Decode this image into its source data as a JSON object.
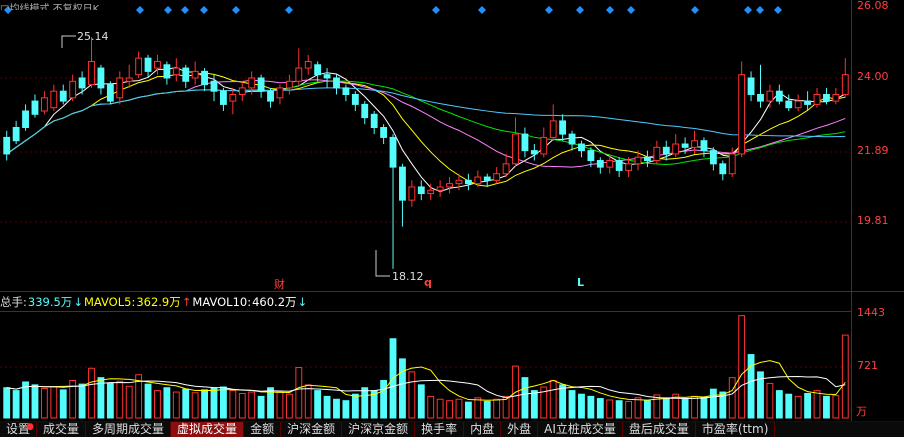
{
  "header": {
    "title": "□均线模式 不复权日K"
  },
  "price_axis": [
    "26.08",
    "24.00",
    "21.89",
    "19.81"
  ],
  "annotations": {
    "high": "25.14",
    "low": "18.12",
    "markers": [
      "财",
      "q",
      "L"
    ]
  },
  "volume_info": {
    "total_label": "总手:",
    "total_value": "339.5万",
    "mavol5_label": "MAVOL5:",
    "mavol5_value": "362.9万",
    "mavol10_label": "MAVOL10:",
    "mavol10_value": "460.2万"
  },
  "volume_axis": [
    "1443",
    "721",
    "万"
  ],
  "tabs": [
    "设置",
    "成交量",
    "多周期成交量",
    "虚拟成交量",
    "金额",
    "沪深金额",
    "沪深京金额",
    "换手率",
    "内盘",
    "外盘",
    "AI立桩成交量",
    "盘后成交量",
    "市盈率(ttm)"
  ],
  "active_tab": 3,
  "colors": {
    "up": "#ff3232",
    "down": "#54fcfc",
    "ma5": "#ffffff",
    "ma10": "#ffff00",
    "ma20": "#ff80ff",
    "ma30": "#00e600",
    "ma60": "#50c8ff",
    "axis": "#b40000",
    "diamond": "#1e90ff"
  },
  "chart_data": {
    "type": "candlestick",
    "ylim": [
      17.6,
      26.08
    ],
    "volume_ylim": [
      0,
      1443
    ],
    "candles": [
      [
        22.1,
        21.6,
        21.4,
        22.3,
        420
      ],
      [
        22.4,
        22.0,
        21.9,
        22.6,
        380
      ],
      [
        22.9,
        22.4,
        22.3,
        23.1,
        500
      ],
      [
        23.2,
        22.8,
        22.7,
        23.4,
        460
      ],
      [
        22.9,
        23.3,
        22.8,
        23.5,
        410
      ],
      [
        23.0,
        23.5,
        22.9,
        23.7,
        430
      ],
      [
        23.5,
        23.2,
        23.1,
        23.7,
        390
      ],
      [
        23.3,
        23.8,
        23.2,
        24.0,
        520
      ],
      [
        23.9,
        23.6,
        23.4,
        24.1,
        470
      ],
      [
        23.7,
        24.4,
        23.6,
        25.14,
        690
      ],
      [
        24.2,
        23.6,
        23.4,
        24.3,
        560
      ],
      [
        23.7,
        23.2,
        23.1,
        23.8,
        480
      ],
      [
        23.3,
        23.9,
        23.1,
        24.1,
        510
      ],
      [
        23.8,
        23.9,
        23.6,
        24.3,
        440
      ],
      [
        24.0,
        24.5,
        23.9,
        24.7,
        600
      ],
      [
        24.5,
        24.1,
        23.9,
        24.6,
        470
      ],
      [
        24.2,
        24.4,
        24.0,
        24.6,
        380
      ],
      [
        24.3,
        23.9,
        23.7,
        24.4,
        420
      ],
      [
        24.0,
        24.2,
        23.8,
        24.5,
        360
      ],
      [
        24.2,
        23.8,
        23.6,
        24.3,
        400
      ],
      [
        23.9,
        24.1,
        23.7,
        24.4,
        350
      ],
      [
        24.1,
        23.7,
        23.5,
        24.2,
        390
      ],
      [
        23.8,
        23.5,
        23.2,
        24.0,
        410
      ],
      [
        23.5,
        23.1,
        22.9,
        23.6,
        430
      ],
      [
        23.2,
        23.4,
        22.8,
        23.6,
        380
      ],
      [
        23.4,
        23.6,
        23.2,
        23.8,
        340
      ],
      [
        23.6,
        23.9,
        23.4,
        24.1,
        360
      ],
      [
        23.9,
        23.5,
        23.3,
        24.0,
        300
      ],
      [
        23.5,
        23.2,
        23.0,
        23.6,
        420
      ],
      [
        23.3,
        23.6,
        23.1,
        23.7,
        360
      ],
      [
        23.6,
        23.8,
        23.4,
        24.0,
        330
      ],
      [
        23.8,
        24.2,
        23.7,
        24.8,
        700
      ],
      [
        24.2,
        24.4,
        24.0,
        24.6,
        460
      ],
      [
        24.3,
        24.0,
        23.8,
        24.4,
        380
      ],
      [
        24.0,
        23.9,
        23.6,
        24.2,
        300
      ],
      [
        23.9,
        23.6,
        23.4,
        24.0,
        260
      ],
      [
        23.6,
        23.4,
        23.2,
        23.7,
        240
      ],
      [
        23.4,
        23.1,
        22.9,
        23.5,
        330
      ],
      [
        23.1,
        22.7,
        22.5,
        23.2,
        420
      ],
      [
        22.8,
        22.4,
        22.2,
        22.9,
        380
      ],
      [
        22.4,
        22.1,
        21.9,
        22.5,
        520
      ],
      [
        22.1,
        21.2,
        18.12,
        22.2,
        1100
      ],
      [
        21.2,
        20.2,
        19.4,
        21.3,
        820
      ],
      [
        20.2,
        20.6,
        20.0,
        20.8,
        640
      ],
      [
        20.6,
        20.4,
        20.2,
        20.8,
        460
      ],
      [
        20.4,
        20.5,
        20.2,
        20.7,
        300
      ],
      [
        20.5,
        20.6,
        20.3,
        20.8,
        260
      ],
      [
        20.6,
        20.7,
        20.4,
        20.9,
        240
      ],
      [
        20.7,
        20.8,
        20.5,
        21.0,
        260
      ],
      [
        20.8,
        20.7,
        20.5,
        21.0,
        220
      ],
      [
        20.7,
        20.9,
        20.6,
        21.1,
        280
      ],
      [
        20.9,
        20.8,
        20.6,
        21.0,
        230
      ],
      [
        20.8,
        21.0,
        20.7,
        21.2,
        260
      ],
      [
        21.0,
        21.3,
        20.9,
        21.6,
        300
      ],
      [
        21.3,
        22.2,
        21.2,
        22.7,
        720
      ],
      [
        22.2,
        21.7,
        21.5,
        22.4,
        560
      ],
      [
        21.7,
        21.6,
        21.4,
        21.9,
        380
      ],
      [
        21.6,
        22.1,
        21.5,
        22.4,
        430
      ],
      [
        22.1,
        22.6,
        22.0,
        23.1,
        520
      ],
      [
        22.6,
        22.2,
        22.0,
        22.8,
        460
      ],
      [
        22.2,
        21.9,
        21.7,
        22.3,
        380
      ],
      [
        21.9,
        21.7,
        21.5,
        22.0,
        330
      ],
      [
        21.7,
        21.4,
        21.2,
        21.8,
        300
      ],
      [
        21.4,
        21.2,
        21.0,
        21.5,
        270
      ],
      [
        21.2,
        21.4,
        21.0,
        21.6,
        250
      ],
      [
        21.4,
        21.1,
        20.9,
        21.5,
        240
      ],
      [
        21.1,
        21.3,
        20.9,
        21.5,
        230
      ],
      [
        21.3,
        21.5,
        21.1,
        21.7,
        280
      ],
      [
        21.5,
        21.4,
        21.2,
        21.7,
        240
      ],
      [
        21.4,
        21.8,
        21.3,
        22.0,
        320
      ],
      [
        21.8,
        21.6,
        21.4,
        22.0,
        280
      ],
      [
        21.6,
        21.9,
        21.5,
        22.2,
        330
      ],
      [
        21.9,
        21.8,
        21.6,
        22.1,
        260
      ],
      [
        21.8,
        22.0,
        21.6,
        22.3,
        300
      ],
      [
        22.0,
        21.7,
        21.5,
        22.1,
        290
      ],
      [
        21.7,
        21.3,
        21.1,
        21.8,
        400
      ],
      [
        21.3,
        21.0,
        20.8,
        21.4,
        360
      ],
      [
        21.0,
        21.6,
        20.9,
        21.8,
        560
      ],
      [
        21.6,
        24.0,
        21.5,
        24.4,
        1420
      ],
      [
        23.9,
        23.4,
        23.2,
        24.1,
        880
      ],
      [
        23.4,
        23.2,
        23.0,
        24.3,
        640
      ],
      [
        23.2,
        23.5,
        23.0,
        23.7,
        480
      ],
      [
        23.5,
        23.2,
        23.1,
        23.7,
        380
      ],
      [
        23.2,
        23.0,
        22.9,
        23.4,
        330
      ],
      [
        23.0,
        23.2,
        22.9,
        23.4,
        300
      ],
      [
        23.2,
        23.1,
        22.9,
        23.5,
        340
      ],
      [
        23.1,
        23.4,
        23.0,
        23.6,
        380
      ],
      [
        23.4,
        23.2,
        23.1,
        23.6,
        300
      ],
      [
        23.2,
        23.4,
        23.1,
        23.6,
        310
      ],
      [
        23.4,
        24.0,
        23.3,
        24.5,
        1150
      ]
    ]
  }
}
